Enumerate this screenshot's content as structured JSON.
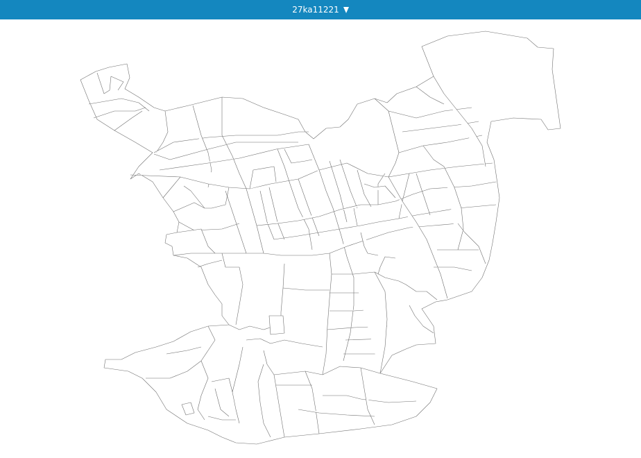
{
  "header": {
    "layer_selector_label": "27ka11221",
    "caret_icon": "triangle-down-icon",
    "background_color": "#1487bf",
    "text_color": "#ffffff"
  },
  "map": {
    "stroke_color": "#6e6e6e",
    "fill_color": "#ffffff"
  }
}
